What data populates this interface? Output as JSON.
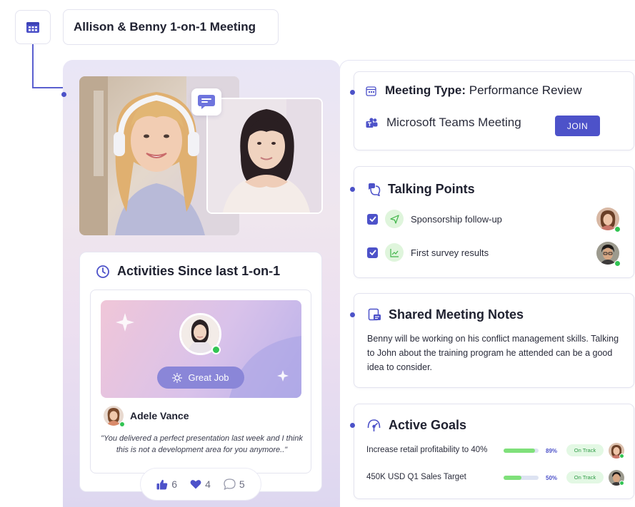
{
  "header": {
    "title": "Allison & Benny 1-on-1 Meeting",
    "icon": "calendar-icon"
  },
  "video": {
    "main_icon": "chat-icon"
  },
  "activities": {
    "title": "Activities Since last 1-on-1",
    "badge_label": "Great Job",
    "person_name": "Adele Vance",
    "quote": "\"You delivered a perfect presentation last week and I think this is not a development area for you anymore..\"",
    "reactions": {
      "likes": "6",
      "hearts": "4",
      "comments": "5"
    }
  },
  "meeting": {
    "type_label": "Meeting Type:",
    "type_value": " Performance Review",
    "platform": "Microsoft Teams Meeting",
    "join_label": "JOIN"
  },
  "talking_points": {
    "title": "Talking Points",
    "items": [
      {
        "label": "Sponsorship follow-up",
        "checked": true
      },
      {
        "label": "First survey results",
        "checked": true
      }
    ]
  },
  "notes": {
    "title": "Shared Meeting Notes",
    "text": "Benny will be working on his conflict management skills. Talking to John about the training program he attended can be a good idea to consider."
  },
  "goals": {
    "title": "Active Goals",
    "items": [
      {
        "label": "Increase retail profitability to 40%",
        "progress": 0.89,
        "percent": "89%",
        "status": "On Track"
      },
      {
        "label": "450K USD Q1 Sales Target",
        "progress": 0.5,
        "percent": "50%",
        "status": "On Track"
      }
    ]
  },
  "colors": {
    "accent": "#4d52c9",
    "success": "#32c453",
    "progress": "#7fe07a"
  }
}
